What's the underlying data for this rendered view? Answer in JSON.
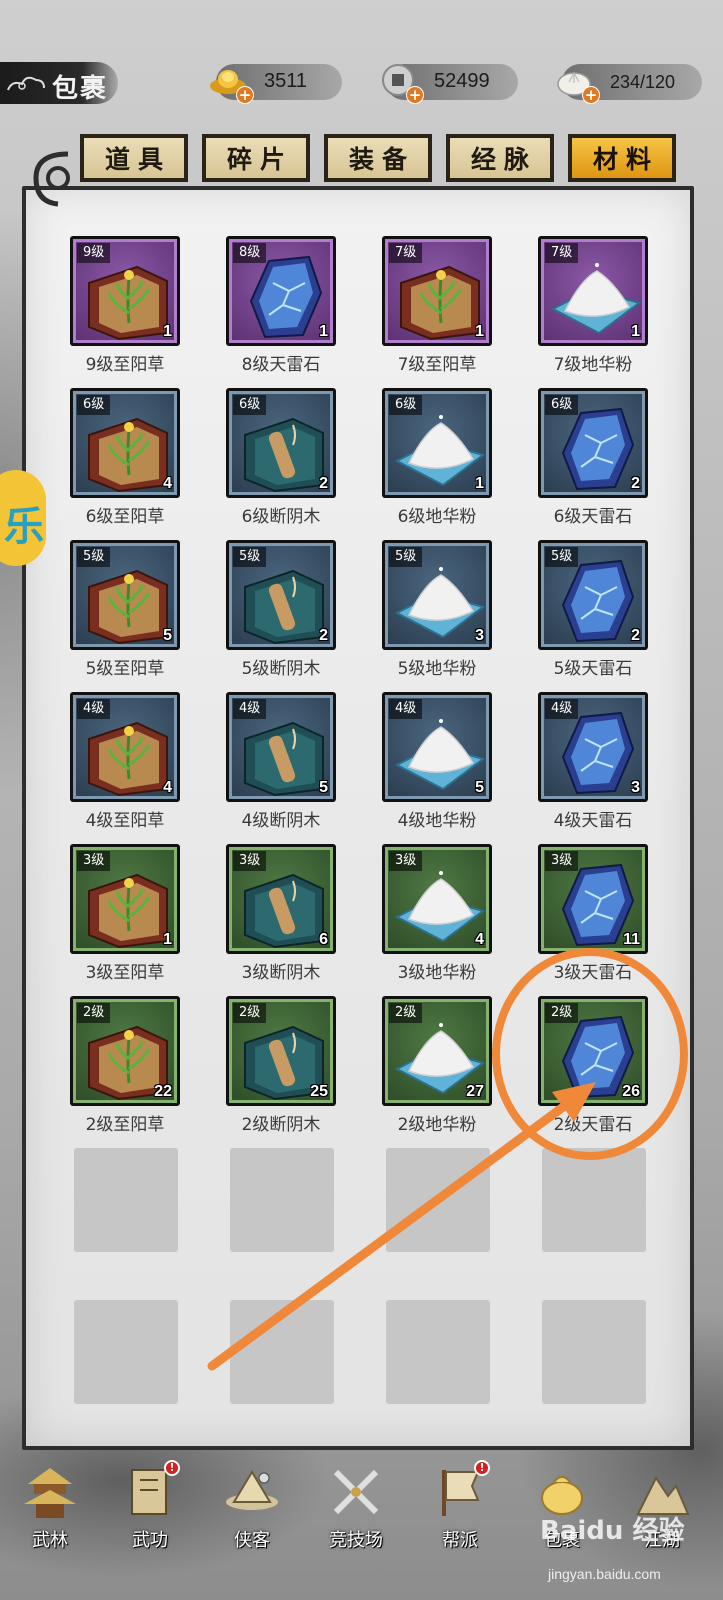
{
  "header": {
    "title": "包裹",
    "gold": "3511",
    "silver": "52499",
    "capacity": "234/120"
  },
  "tabs": [
    {
      "label": "道具",
      "active": false
    },
    {
      "label": "碎片",
      "active": false
    },
    {
      "label": "装备",
      "active": false
    },
    {
      "label": "经脉",
      "active": false
    },
    {
      "label": "材料",
      "active": true
    }
  ],
  "items": [
    {
      "level": "9级",
      "qty": "1",
      "name": "9级至阳草",
      "kind": "herb",
      "rarity": "purple"
    },
    {
      "level": "8级",
      "qty": "1",
      "name": "8级天雷石",
      "kind": "stone",
      "rarity": "purple"
    },
    {
      "level": "7级",
      "qty": "1",
      "name": "7级至阳草",
      "kind": "herb",
      "rarity": "purple"
    },
    {
      "level": "7级",
      "qty": "1",
      "name": "7级地华粉",
      "kind": "powder",
      "rarity": "purple"
    },
    {
      "level": "6级",
      "qty": "4",
      "name": "6级至阳草",
      "kind": "herb",
      "rarity": "blue"
    },
    {
      "level": "6级",
      "qty": "2",
      "name": "6级断阴木",
      "kind": "wood",
      "rarity": "blue"
    },
    {
      "level": "6级",
      "qty": "1",
      "name": "6级地华粉",
      "kind": "powder",
      "rarity": "blue"
    },
    {
      "level": "6级",
      "qty": "2",
      "name": "6级天雷石",
      "kind": "stone",
      "rarity": "blue"
    },
    {
      "level": "5级",
      "qty": "5",
      "name": "5级至阳草",
      "kind": "herb",
      "rarity": "blue"
    },
    {
      "level": "5级",
      "qty": "2",
      "name": "5级断阴木",
      "kind": "wood",
      "rarity": "blue"
    },
    {
      "level": "5级",
      "qty": "3",
      "name": "5级地华粉",
      "kind": "powder",
      "rarity": "blue"
    },
    {
      "level": "5级",
      "qty": "2",
      "name": "5级天雷石",
      "kind": "stone",
      "rarity": "blue"
    },
    {
      "level": "4级",
      "qty": "4",
      "name": "4级至阳草",
      "kind": "herb",
      "rarity": "blue"
    },
    {
      "level": "4级",
      "qty": "5",
      "name": "4级断阴木",
      "kind": "wood",
      "rarity": "blue"
    },
    {
      "level": "4级",
      "qty": "5",
      "name": "4级地华粉",
      "kind": "powder",
      "rarity": "blue"
    },
    {
      "level": "4级",
      "qty": "3",
      "name": "4级天雷石",
      "kind": "stone",
      "rarity": "blue"
    },
    {
      "level": "3级",
      "qty": "1",
      "name": "3级至阳草",
      "kind": "herb",
      "rarity": "green"
    },
    {
      "level": "3级",
      "qty": "6",
      "name": "3级断阴木",
      "kind": "wood",
      "rarity": "green"
    },
    {
      "level": "3级",
      "qty": "4",
      "name": "3级地华粉",
      "kind": "powder",
      "rarity": "green"
    },
    {
      "level": "3级",
      "qty": "11",
      "name": "3级天雷石",
      "kind": "stone",
      "rarity": "green"
    },
    {
      "level": "2级",
      "qty": "22",
      "name": "2级至阳草",
      "kind": "herb",
      "rarity": "green"
    },
    {
      "level": "2级",
      "qty": "25",
      "name": "2级断阴木",
      "kind": "wood",
      "rarity": "green"
    },
    {
      "level": "2级",
      "qty": "27",
      "name": "2级地华粉",
      "kind": "powder",
      "rarity": "green"
    },
    {
      "level": "2级",
      "qty": "26",
      "name": "2级天雷石",
      "kind": "stone",
      "rarity": "green"
    }
  ],
  "empty_slots": 8,
  "side_badge": "乐",
  "nav": [
    {
      "label": "武林",
      "icon": "pavilion-icon",
      "alert": false
    },
    {
      "label": "武功",
      "icon": "scroll-icon",
      "alert": true
    },
    {
      "label": "侠客",
      "icon": "hat-icon",
      "alert": false
    },
    {
      "label": "竞技场",
      "icon": "crossed-swords-icon",
      "alert": false
    },
    {
      "label": "帮派",
      "icon": "banner-icon",
      "alert": true
    },
    {
      "label": "包裹",
      "icon": "bag-icon",
      "alert": false
    },
    {
      "label": "江湖",
      "icon": "mountain-icon",
      "alert": false
    }
  ],
  "watermark": {
    "brand": "Baidu 经验",
    "url": "jingyan.baidu.com"
  },
  "annotation_color": "#f0883a"
}
